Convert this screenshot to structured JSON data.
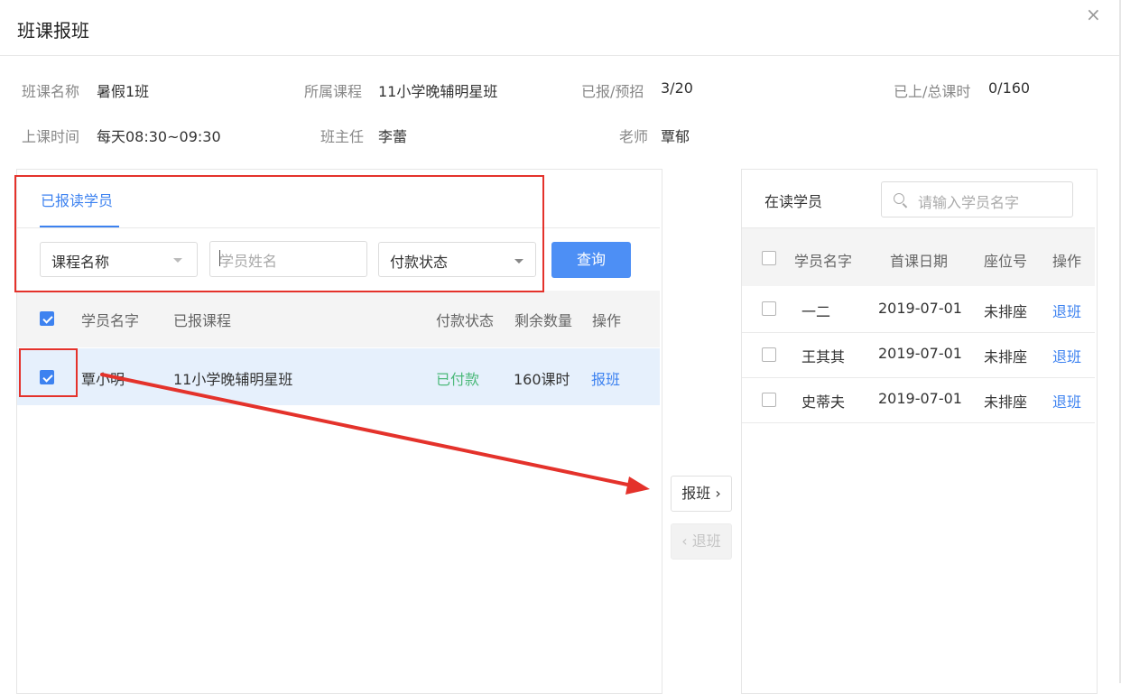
{
  "dialog": {
    "title": "班课报班",
    "close": "×"
  },
  "info": {
    "class_name_label": "班课名称",
    "class_name": "暑假1班",
    "course_label": "所属课程",
    "course": "11小学晚辅明星班",
    "enrolled_label": "已报/预招",
    "enrolled": "3/20",
    "hours_label": "已上/总课时",
    "hours": "0/160",
    "time_label": "上课时间",
    "time": "每天08:30~09:30",
    "head_teacher_label": "班主任",
    "head_teacher": "李蕾",
    "teacher_label": "老师",
    "teacher": "覃郁"
  },
  "left_panel": {
    "tab": "已报读学员",
    "filters": {
      "course_select": "课程名称",
      "name_placeholder": "学员姓名",
      "payment_select": "付款状态",
      "query_button": "查询"
    },
    "columns": [
      "学员名字",
      "已报课程",
      "付款状态",
      "剩余数量",
      "操作"
    ],
    "rows": [
      {
        "name": "覃小明",
        "course": "11小学晚辅明星班",
        "payment": "已付款",
        "remaining": "160课时",
        "action": "报班",
        "checked": true
      }
    ]
  },
  "transfer": {
    "enroll_button": "报班",
    "enroll_arrow": "›",
    "withdraw_arrow": "‹",
    "withdraw_button": "退班"
  },
  "right_panel": {
    "title": "在读学员",
    "search_placeholder": "请输入学员名字",
    "columns": [
      "学员名字",
      "首课日期",
      "座位号",
      "操作"
    ],
    "rows": [
      {
        "name": "一二",
        "date": "2019-07-01",
        "seat": "未排座",
        "action": "退班"
      },
      {
        "name": "王其其",
        "date": "2019-07-01",
        "seat": "未排座",
        "action": "退班"
      },
      {
        "name": "史蒂夫",
        "date": "2019-07-01",
        "seat": "未排座",
        "action": "退班"
      }
    ]
  },
  "colors": {
    "accent": "#3d82f0",
    "primary_button": "#4d8ff5",
    "paid": "#4cb97a",
    "annotation": "#e4322b",
    "selected_row": "#e6f0fc"
  }
}
